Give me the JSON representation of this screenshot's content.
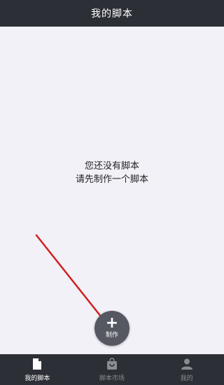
{
  "header": {
    "title": "我的脚本"
  },
  "main": {
    "empty_line1": "您还没有脚本",
    "empty_line2": "请先制作一个脚本"
  },
  "fab": {
    "icon": "plus-icon",
    "label": "制作"
  },
  "tabs": [
    {
      "label": "我的脚本",
      "icon": "document-icon",
      "active": true
    },
    {
      "label": "脚本市场",
      "icon": "shopping-bag-icon",
      "active": false
    },
    {
      "label": "我的",
      "icon": "user-icon",
      "active": false
    }
  ],
  "colors": {
    "header_bg": "#2d2f36",
    "page_bg": "#f2f1f7",
    "fab_bg": "#555860",
    "annotation_arrow": "#d02020"
  }
}
